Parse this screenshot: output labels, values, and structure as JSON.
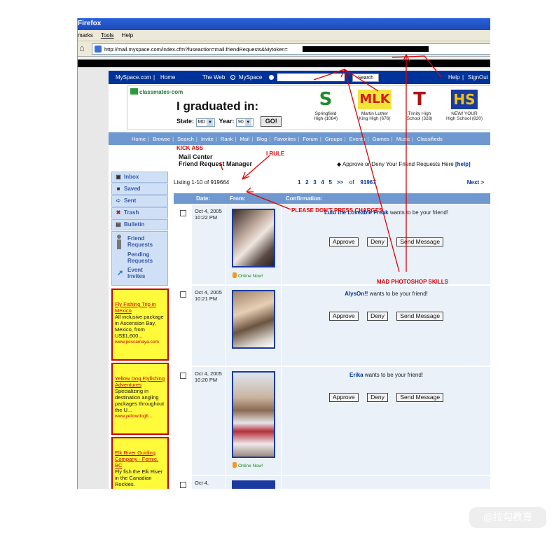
{
  "browser": {
    "title": "Firefox",
    "menu": [
      "marks",
      "Tools",
      "Help"
    ],
    "url": "http://mail.myspace.com/index.cfm?fuseaction=mail.friendRequests&Mytoken="
  },
  "topnav": {
    "brand": "MySpace.com",
    "home": "Home",
    "the_web": "The Web",
    "myspace": "MySpace",
    "search_button": "Search",
    "help": "Help",
    "signout": "SignOut"
  },
  "banner": {
    "logo": "classmates·com",
    "headline": "I graduated in:",
    "state_label": "State:",
    "state_value": "MD",
    "year_label": "Year:",
    "year_value": "90",
    "go": "GO!",
    "schools": [
      {
        "letter": "S",
        "line1": "Springfield",
        "line2": "High (1084)"
      },
      {
        "letter": "MLK",
        "line1": "Martin Luther",
        "line2": "King High (676)"
      },
      {
        "letter": "T",
        "line1": "Trinity High",
        "line2": "School (328)"
      },
      {
        "letter": "HS",
        "line1": "NEW! YOUR",
        "line2": "High School (820)"
      }
    ]
  },
  "subnav": [
    "Home",
    "Browse",
    "Search",
    "Invite",
    "Rank",
    "Mail",
    "Blog",
    "Favorites",
    "Forum",
    "Groups",
    "Events",
    "Games",
    "Music",
    "Classifieds"
  ],
  "mail": {
    "center": "Mail Center",
    "manager": "Friend Request Manager",
    "approve_note": "Approve or Deny Your Friend Requests Here",
    "help": "[help]"
  },
  "sidebar": {
    "items": [
      {
        "icon": "inbox-icon",
        "label": "Inbox"
      },
      {
        "icon": "saved-icon",
        "label": "Saved"
      },
      {
        "icon": "sent-icon",
        "label": "Sent"
      },
      {
        "icon": "trash-icon",
        "label": "Trash"
      },
      {
        "icon": "bulletin-icon",
        "label": "Bulletin"
      }
    ],
    "friend_requests": "Friend Requests",
    "pending_requests": "Pending Requests",
    "event_invites": "Event Invites"
  },
  "ads": [
    {
      "title": "Fly Fishing Trip in Mexico",
      "body": "All inclusive package in Ascension Bay, Mexico, from US$1,600...",
      "url": "www.pescamaya.com"
    },
    {
      "title": "Yellow Dog Flyfishing Adventures",
      "body": "Specializing in destination angling packages throughout the U...",
      "url": "www.yellowdogfl..."
    },
    {
      "title": "Elk River Guiding Company - Fernie, BC",
      "body": "Fly fish the Elk River in the Canadian Rockies.",
      "url": ""
    }
  ],
  "listing": {
    "text": "Listing 1-10 of 919664",
    "pages": [
      "1",
      "2",
      "3",
      "4",
      "5",
      ">>"
    ],
    "of": "of",
    "total_pages": "91967",
    "next": "Next >"
  },
  "table": {
    "headers": [
      "Date:",
      "From:",
      "Confirmation:"
    ],
    "rows": [
      {
        "date": "Oct 4, 2005 10:22 PM",
        "name": "Lulu the Loveable Freak",
        "msg": "wants to be your friend!",
        "online": "Online Now!"
      },
      {
        "date": "Oct 4, 2005 10:21 PM",
        "name": "AlysOn!!",
        "msg": "wants to be your friend!",
        "online": ""
      },
      {
        "date": "Oct 4, 2005 10:20 PM",
        "name": "Erika",
        "msg": "wants to be your friend!",
        "online": "Online Now!"
      },
      {
        "date": "Oct 4,",
        "name": "",
        "msg": "",
        "online": ""
      }
    ],
    "approve": "Approve",
    "deny": "Deny",
    "send_message": "Send Message"
  },
  "annotations": {
    "kick_ass": "KICK ASS",
    "i_rule": "I RULE",
    "dont_press": "PLEASE DON'T PRESS CHARGES",
    "photoshop": "MAD PHOTOSHOP SKILLS",
    "color": "#e00000"
  },
  "watermark": "@拉勾教育"
}
